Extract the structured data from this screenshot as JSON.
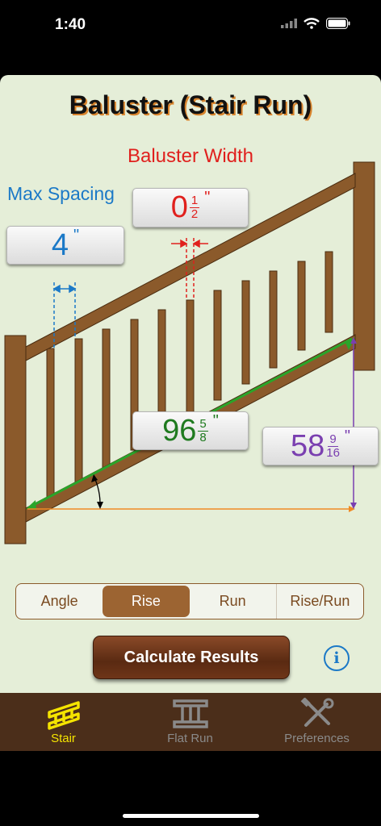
{
  "status": {
    "time": "1:40"
  },
  "page": {
    "title": "Baluster (Stair Run)"
  },
  "diagram": {
    "baluster_width_label": "Baluster Width",
    "max_spacing_label": "Max Spacing",
    "baluster_width": {
      "whole": "0",
      "num": "1",
      "den": "2",
      "unit": "\""
    },
    "max_spacing": {
      "whole": "4",
      "unit": "\""
    },
    "run_length": {
      "whole": "96",
      "num": "5",
      "den": "8",
      "unit": "\""
    },
    "rise_height": {
      "whole": "58",
      "num": "9",
      "den": "16",
      "unit": "\""
    }
  },
  "segments": {
    "items": [
      "Angle",
      "Rise",
      "Run",
      "Rise/Run"
    ],
    "selected": "Rise"
  },
  "actions": {
    "calculate_label": "Calculate Results",
    "info_glyph": "i"
  },
  "tabs": [
    {
      "label": "Stair",
      "icon": "stair-icon",
      "active": true
    },
    {
      "label": "Flat Run",
      "icon": "flat-run-icon",
      "active": false
    },
    {
      "label": "Preferences",
      "icon": "tools-icon",
      "active": false
    }
  ],
  "colors": {
    "accent_red": "#e0201d",
    "accent_blue": "#1b79c7",
    "green": "#1f7a1f",
    "purple": "#7a3fb0",
    "wood": "#8b5a2b",
    "tab_active": "#f5e400",
    "background": "#e5eed8"
  }
}
